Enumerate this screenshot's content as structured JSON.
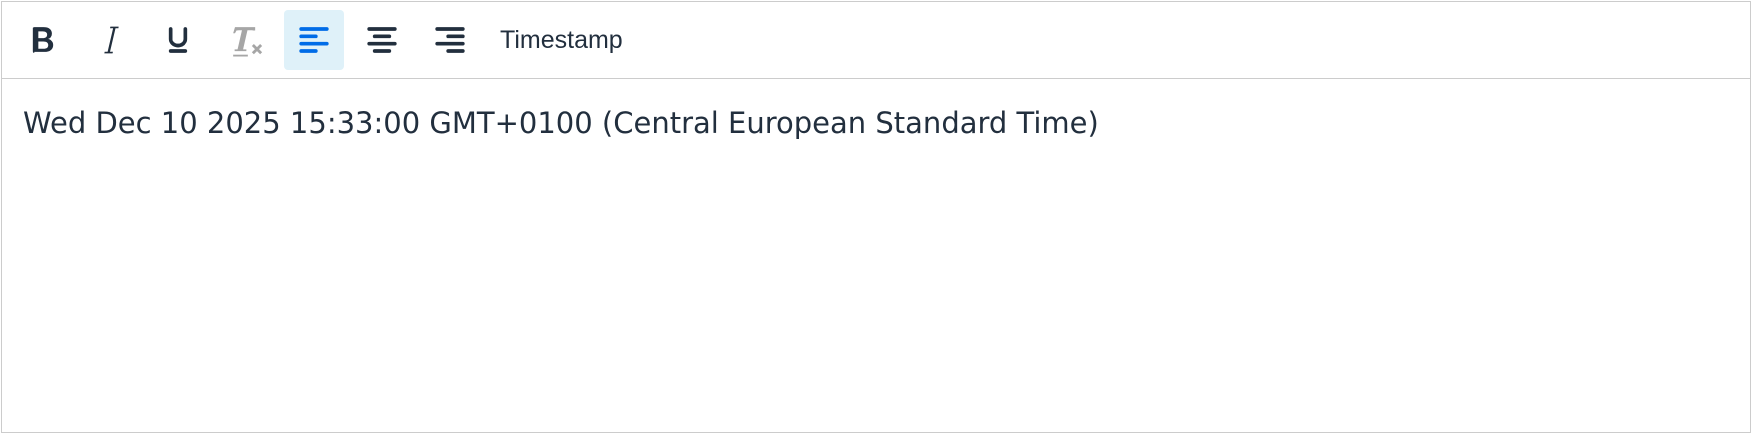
{
  "toolbar": {
    "buttons": [
      {
        "id": "bold",
        "icon": "bold-icon",
        "state": "normal"
      },
      {
        "id": "italic",
        "icon": "italic-icon",
        "state": "normal"
      },
      {
        "id": "underline",
        "icon": "underline-icon",
        "state": "normal"
      },
      {
        "id": "remove-format",
        "icon": "remove-format-icon",
        "state": "disabled"
      },
      {
        "id": "align-left",
        "icon": "align-left-icon",
        "state": "active"
      },
      {
        "id": "align-center",
        "icon": "align-center-icon",
        "state": "normal"
      },
      {
        "id": "align-right",
        "icon": "align-right-icon",
        "state": "normal"
      }
    ],
    "timestamp_label": "Timestamp"
  },
  "content": {
    "text": "Wed Dec 10 2025 15:33:00 GMT+0100 (Central European Standard Time)"
  },
  "colors": {
    "text": "#222f3e",
    "active_background": "#dff1f9",
    "active_icon": "#006ce7",
    "disabled_icon": "#a6a6a6",
    "border": "#cccccc"
  }
}
